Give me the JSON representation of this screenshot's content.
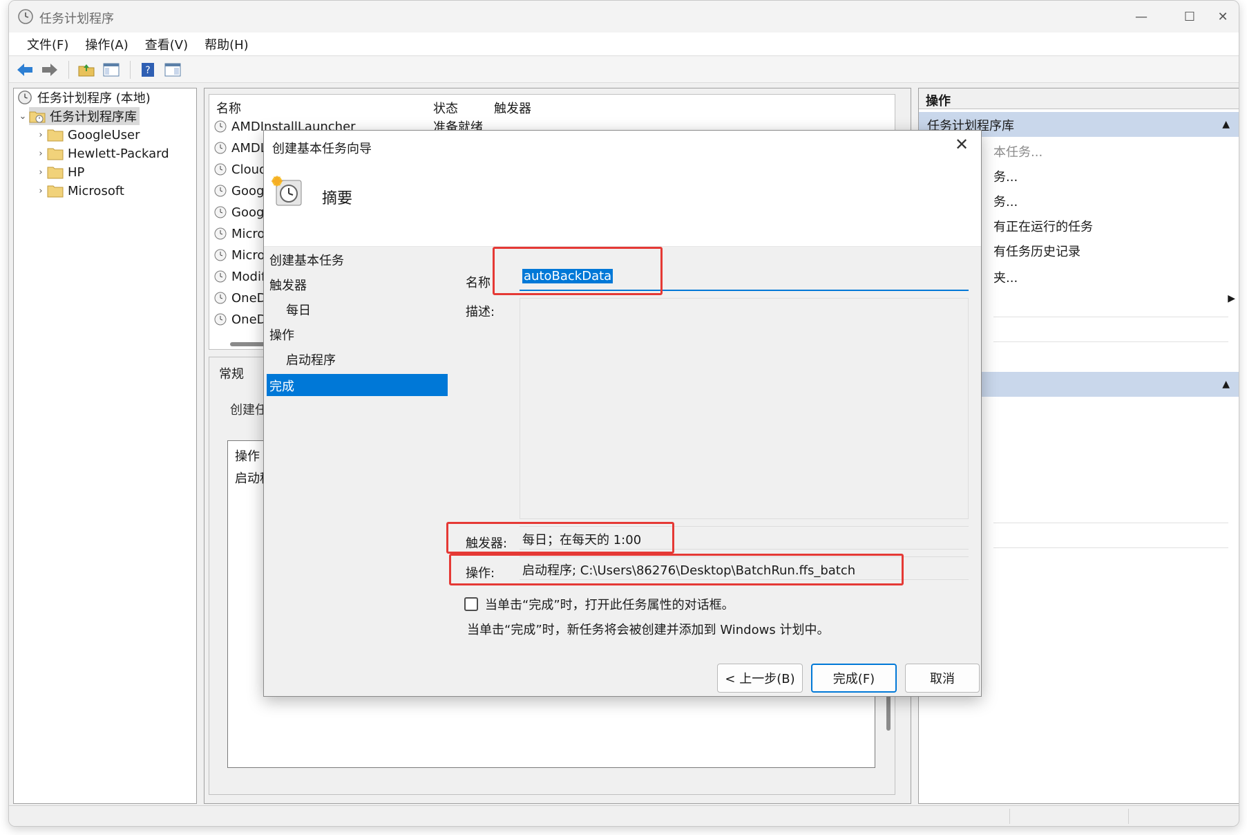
{
  "window": {
    "title": "任务计划程序",
    "minimize": "—",
    "maximize": "☐",
    "close": "✕"
  },
  "menu": {
    "items": [
      "文件(F)",
      "操作(A)",
      "查看(V)",
      "帮助(H)"
    ]
  },
  "toolbar": {
    "icons": [
      "back-arrow-icon",
      "forward-arrow-icon",
      "folder-up-icon",
      "panel-view-icon",
      "help-icon",
      "panel-layout-icon"
    ]
  },
  "tree": {
    "root": "任务计划程序 (本地)",
    "library": "任务计划程序库",
    "folders": [
      "GoogleUser",
      "Hewlett-Packard",
      "HP",
      "Microsoft"
    ]
  },
  "list": {
    "columns": [
      "名称",
      "状态",
      "触发器"
    ],
    "rows": [
      {
        "name": "AMDInstallLauncher",
        "status": "准备就绪"
      },
      {
        "name": "AMDL"
      },
      {
        "name": "Cloud"
      },
      {
        "name": "Googl"
      },
      {
        "name": "Googl"
      },
      {
        "name": "Micros"
      },
      {
        "name": "Micros"
      },
      {
        "name": "Modif"
      },
      {
        "name": "OneD"
      },
      {
        "name": "OneD"
      }
    ]
  },
  "detail": {
    "tab": "常规",
    "text": "创建任",
    "box_title": "操作",
    "box_value": "启动程"
  },
  "right_pane": {
    "header": "操作",
    "section1": "任务计划程序库",
    "items": [
      "本任务...",
      "务...",
      "务...",
      "有正在运行的任务",
      "有任务历史记录",
      "夹..."
    ],
    "expand_arrow": "▶",
    "collapse_arrow": "▲"
  },
  "dialog": {
    "title": "创建基本任务向导",
    "close": "✕",
    "header_title": "摘要",
    "steps": [
      "创建基本任务",
      "触发器",
      "每日",
      "操作",
      "启动程序",
      "完成"
    ],
    "name_label": "名称",
    "name_value": "autoBackData",
    "desc_label": "描述:",
    "trigger_label": "触发器:",
    "trigger_value": "每日；在每天的 1:00",
    "action_label": "操作:",
    "action_value": "启动程序; C:\\Users\\86276\\Desktop\\BatchRun.ffs_batch",
    "checkbox_label": "当单击“完成”时，打开此任务属性的对话框。",
    "hint": "当单击“完成”时，新任务将会被创建并添加到 Windows 计划中。",
    "buttons": {
      "back": "< 上一步(B)",
      "finish": "完成(F)",
      "cancel": "取消"
    }
  },
  "colors": {
    "accent": "#0078d7",
    "highlight_box": "#e53935",
    "section_bg": "#c9d7eb"
  }
}
